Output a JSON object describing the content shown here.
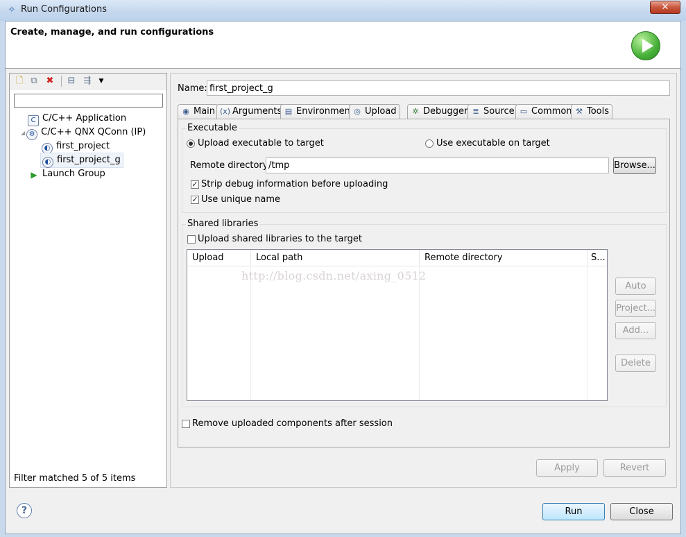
{
  "window": {
    "title": "Run Configurations",
    "close_glyph": "✕"
  },
  "header": {
    "title": "Create, manage, and run configurations",
    "run_icon": "run-large-icon"
  },
  "left": {
    "toolbar": [
      "new-config-icon",
      "duplicate-icon",
      "delete-icon",
      "collapse-all-icon",
      "filter-icon",
      "dropdown-arrow-icon"
    ],
    "filter_placeholder": "",
    "tree": [
      {
        "label": "C/C++ Application",
        "icon": "c-app-icon",
        "level": 0
      },
      {
        "label": "C/C++ QNX QConn (IP)",
        "icon": "qnx-icon",
        "level": 0
      },
      {
        "label": "first_project",
        "icon": "launch-config-icon",
        "level": 1
      },
      {
        "label": "first_project_g",
        "icon": "launch-config-icon",
        "level": 1,
        "selected": true
      },
      {
        "label": "Launch Group",
        "icon": "launch-group-icon",
        "level": 0
      }
    ],
    "status": "Filter matched 5 of 5 items"
  },
  "right": {
    "name_label": "Name:",
    "name_value": "first_project_g",
    "tabs": [
      {
        "label": "Main",
        "icon": "main-tab-icon"
      },
      {
        "label": "Arguments",
        "icon": "arguments-tab-icon"
      },
      {
        "label": "Environment",
        "icon": "environment-tab-icon"
      },
      {
        "label": "Upload",
        "icon": "upload-tab-icon",
        "active": true
      },
      {
        "label": "Debugger",
        "icon": "debugger-tab-icon"
      },
      {
        "label": "Source",
        "icon": "source-tab-icon"
      },
      {
        "label": "Common",
        "icon": "common-tab-icon"
      },
      {
        "label": "Tools",
        "icon": "tools-tab-icon"
      }
    ],
    "executable": {
      "group_label": "Executable",
      "radio_upload": "Upload executable to target",
      "radio_use": "Use executable on target",
      "remote_dir_label": "Remote directory:",
      "remote_dir_value": "/tmp",
      "browse": "Browse...",
      "strip_debug": "Strip debug information before uploading",
      "unique_name": "Use unique name"
    },
    "shared": {
      "group_label": "Shared libraries",
      "upload_libs": "Upload shared libraries to the target",
      "columns": [
        "Upload",
        "Local path",
        "Remote directory",
        "S..."
      ],
      "buttons": {
        "auto": "Auto",
        "project": "Project...",
        "add": "Add...",
        "delete": "Delete"
      }
    },
    "remove_uploaded": "Remove uploaded components after session",
    "apply": "Apply",
    "revert": "Revert",
    "watermark": "http://blog.csdn.net/axing_0512"
  },
  "footer": {
    "help": "?",
    "run": "Run",
    "close": "Close"
  }
}
